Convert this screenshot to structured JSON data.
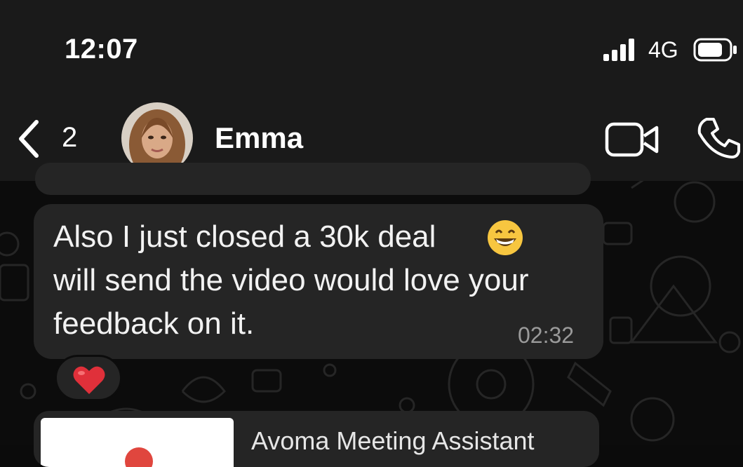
{
  "status_bar": {
    "time": "12:07",
    "network": "4G"
  },
  "nav": {
    "back_count": "2",
    "contact_name": "Emma"
  },
  "message": {
    "lines": [
      "Also I just closed a 30k deal",
      "will send the video would love your",
      "feedback on it."
    ],
    "emoji": "grinning-face-icon",
    "time": "02:32",
    "reaction": "heart-icon"
  },
  "next_message": {
    "title": "Avoma Meeting Assistant"
  },
  "colors": {
    "bar_bg": "#1a1a1a",
    "bubble_bg": "#252525",
    "chat_bg": "#0c0c0c",
    "heart": "#e0303a"
  }
}
